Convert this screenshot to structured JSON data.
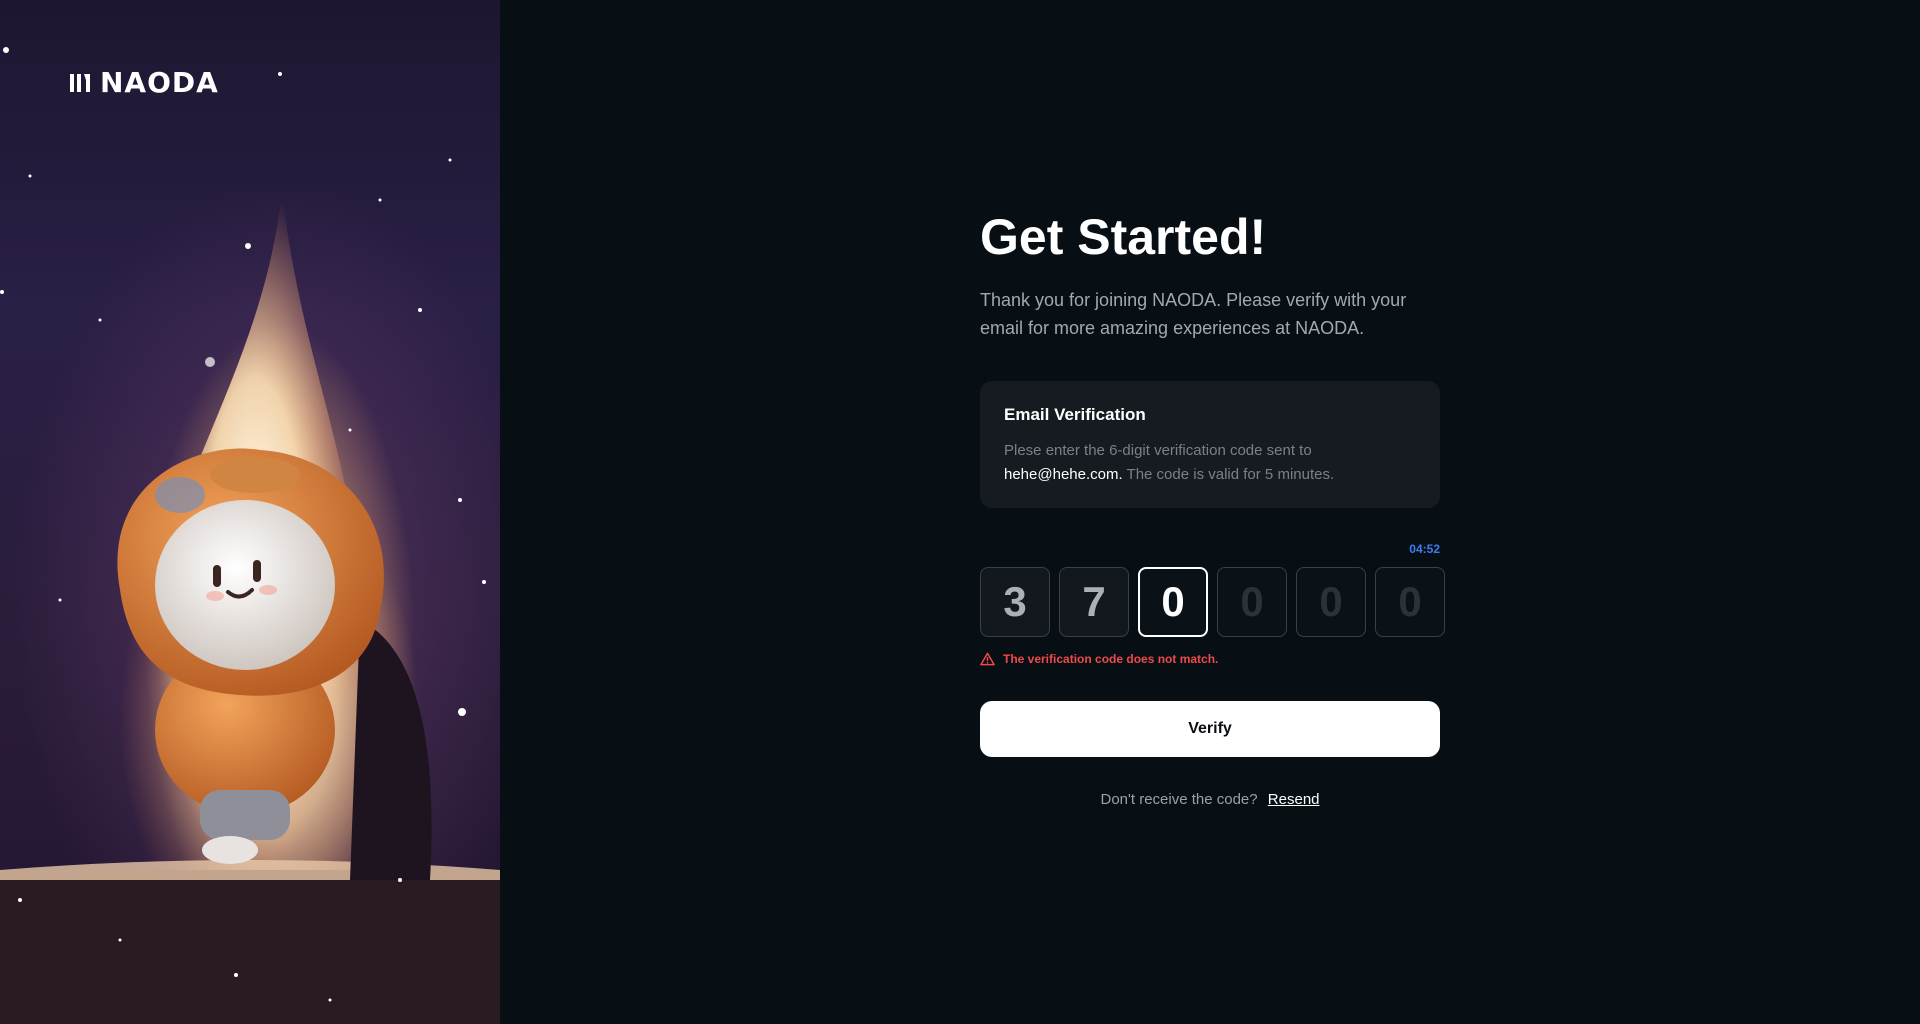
{
  "brand": {
    "name": "NAODA",
    "logo_icon": "naoda-logo-icon"
  },
  "heading": {
    "title": "Get Started!",
    "subtitle": "Thank you for joining NAODA. Please verify with your email for more amazing experiences at NAODA."
  },
  "verification_card": {
    "title": "Email Verification",
    "text_before": "Plese enter the 6-digit verification code sent to",
    "email": "hehe@hehe.com.",
    "text_after": " The code is valid for 5 minutes."
  },
  "timer": "04:52",
  "otp": {
    "digits": [
      "3",
      "7",
      "0",
      "0",
      "0",
      "0"
    ],
    "states": [
      "filled",
      "filled",
      "active",
      "empty",
      "empty",
      "empty"
    ]
  },
  "error": {
    "icon": "warning-triangle-icon",
    "message": "The verification code does not match."
  },
  "verify_button": {
    "label": "Verify"
  },
  "resend": {
    "prompt": "Don't receive the code?",
    "link": "Resend"
  },
  "colors": {
    "background": "#080f14",
    "error": "#ef4a4a",
    "timer": "#3d7df0",
    "card": "#151b21",
    "button": "#ffffff"
  }
}
